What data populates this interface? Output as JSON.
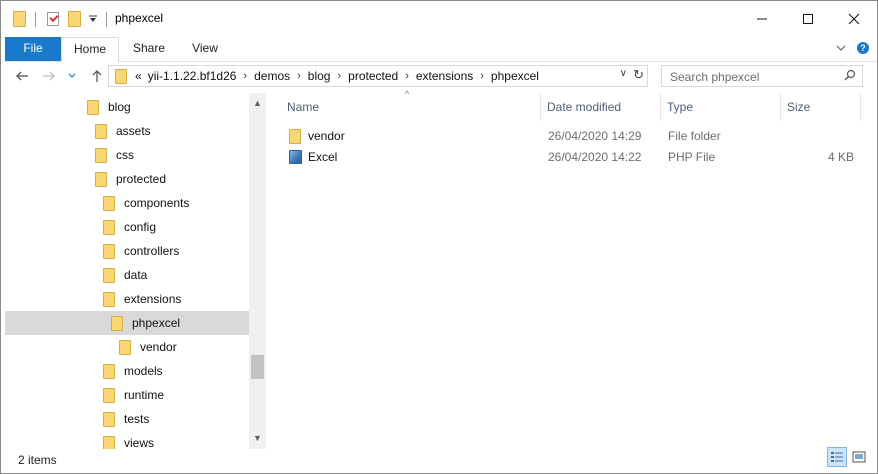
{
  "window": {
    "title": "phpexcel",
    "controls": {
      "minimize": "—",
      "maximize": "☐",
      "close": "✕"
    }
  },
  "ribbon": {
    "tabs": [
      {
        "label": "File"
      },
      {
        "label": "Home"
      },
      {
        "label": "Share"
      },
      {
        "label": "View"
      }
    ],
    "expand_glyph": "⌄",
    "help_glyph": "?"
  },
  "address_bar": {
    "overflow": "«",
    "crumbs": [
      "yii-1.1.22.bf1d26",
      "demos",
      "blog",
      "protected",
      "extensions",
      "phpexcel"
    ],
    "separator": "›",
    "dropdown_glyph": "∨",
    "refresh_glyph": "↻"
  },
  "nav_buttons": {
    "back": "←",
    "forward": "→",
    "recent": "⌄",
    "up": "↑"
  },
  "search": {
    "placeholder": "Search phpexcel"
  },
  "nav_tree": {
    "items": [
      {
        "label": "blog"
      },
      {
        "label": "assets"
      },
      {
        "label": "css"
      },
      {
        "label": "protected"
      },
      {
        "label": "components"
      },
      {
        "label": "config"
      },
      {
        "label": "controllers"
      },
      {
        "label": "data"
      },
      {
        "label": "extensions"
      },
      {
        "label": "phpexcel",
        "selected": true
      },
      {
        "label": "vendor"
      },
      {
        "label": "models"
      },
      {
        "label": "runtime"
      },
      {
        "label": "tests"
      },
      {
        "label": "views"
      }
    ]
  },
  "file_list": {
    "sort_glyph": "^",
    "columns": [
      "Name",
      "Date modified",
      "Type",
      "Size"
    ],
    "rows": [
      {
        "icon": "folder-icon",
        "name": "vendor",
        "date": "26/04/2020 14:29",
        "type": "File folder",
        "size": ""
      },
      {
        "icon": "php-file-icon",
        "name": "Excel",
        "date": "26/04/2020 14:22",
        "type": "PHP File",
        "size": "4 KB"
      }
    ]
  },
  "status_bar": {
    "item_count": "2 items"
  },
  "colors": {
    "accent": "#1979ca",
    "selection": "#d9d9d9",
    "folder": "#f8d775",
    "header_text": "#4c607a"
  }
}
